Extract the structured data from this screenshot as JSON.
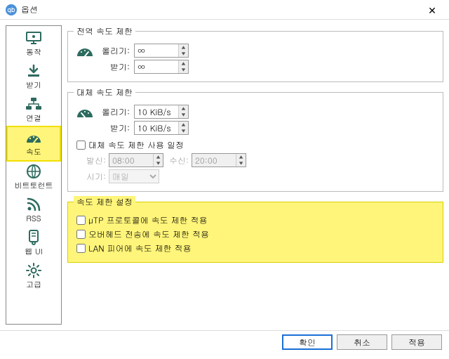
{
  "window": {
    "title": "옵션"
  },
  "sidebar": {
    "items": [
      {
        "label": "동작"
      },
      {
        "label": "받기"
      },
      {
        "label": "연결"
      },
      {
        "label": "속도"
      },
      {
        "label": "비트토런트"
      },
      {
        "label": "RSS"
      },
      {
        "label": "웹 UI"
      },
      {
        "label": "고급"
      }
    ]
  },
  "global": {
    "legend": "전역 속도 제한",
    "up_label": "올리기:",
    "down_label": "받기:",
    "up_value": "∞",
    "down_value": "∞"
  },
  "alt": {
    "legend": "대체 속도 제한",
    "up_label": "올리기:",
    "down_label": "받기:",
    "up_value": "10 KiB/s",
    "down_value": "10 KiB/s",
    "schedule_label": "대체 속도 제한 사용 일정",
    "from_label": "발신:",
    "from_value": "08:00",
    "to_label": "수신:",
    "to_value": "20:00",
    "when_label": "시기:",
    "when_value": "매일"
  },
  "settings": {
    "legend": "속도 제한 설정",
    "utp": "µTP 프로토콜에 속도 제한 적용",
    "overhead": "오버헤드 전송에 속도 제한 적용",
    "lan": "LAN 피어에 속도 제한 적용"
  },
  "buttons": {
    "ok": "확인",
    "cancel": "취소",
    "apply": "적용"
  }
}
